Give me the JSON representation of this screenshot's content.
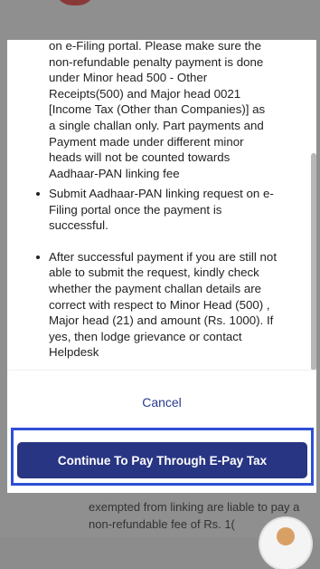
{
  "dialog": {
    "top_paragraph": "on e-Filing portal. Please make sure the non-refundable penalty payment is done under Minor head 500 - Other Receipts(500) and Major head 0021 [Income Tax (Other than Companies)] as a single challan only. Part payments and Payment made under different minor heads will not be counted towards Aadhaar-PAN linking fee",
    "bullets": [
      "Submit Aadhaar-PAN linking request on e-Filing portal once the payment is successful.",
      "After successful payment if you are still not able to submit the request, kindly check whether the payment challan details are correct with respect to Minor Head (500) , Major head (21) and amount (Rs. 1000). If yes, then lodge grievance or contact Helpdesk"
    ],
    "cancel_label": "Cancel",
    "continue_label": "Continue To Pay Through E-Pay Tax"
  },
  "background": {
    "text": "exempted from linking are liable to pay a non-refundable fee of Rs. 1("
  },
  "colors": {
    "primary_button": "#283583",
    "cancel_text": "#2a3b8f",
    "highlight_border": "#2f4fd6"
  }
}
